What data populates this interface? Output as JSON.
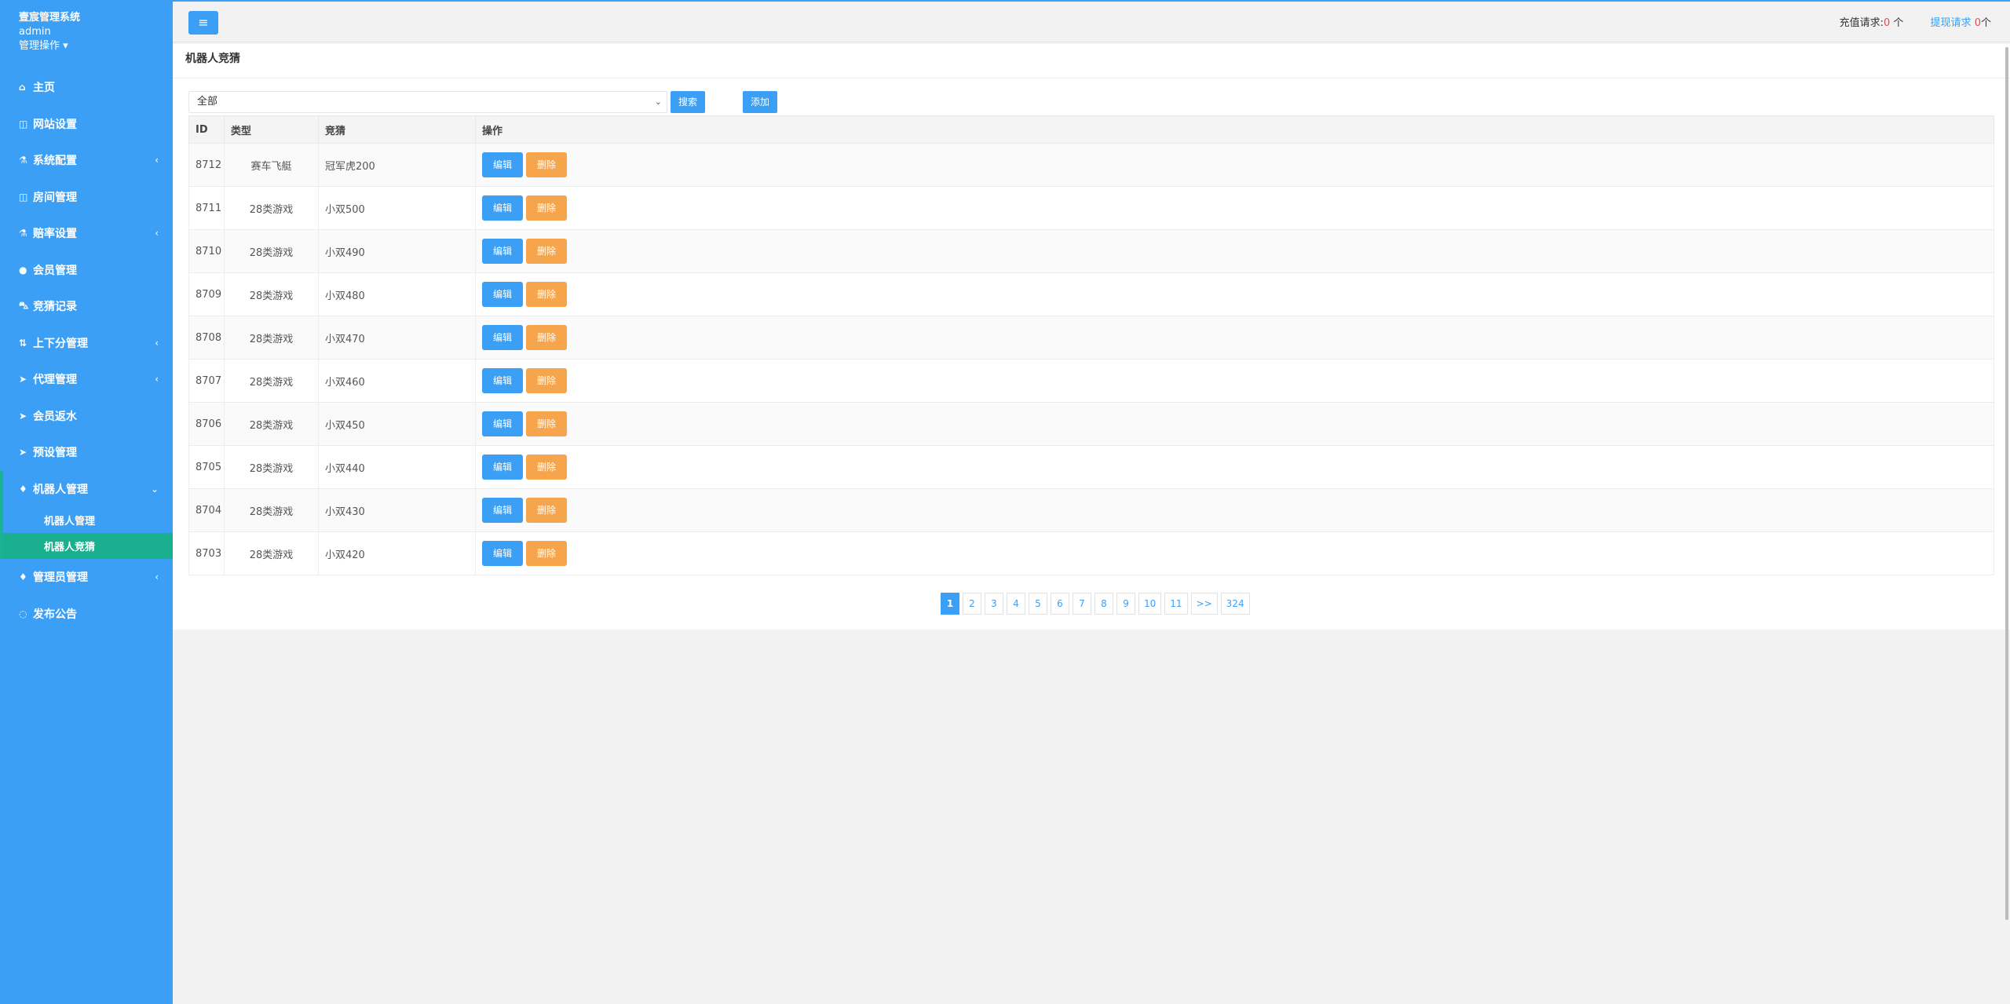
{
  "brand": {
    "title": "壹宸管理系统",
    "user": "admin",
    "role": "管理操作 ▾"
  },
  "nav": [
    {
      "icon": "⌂",
      "icon_name": "home-icon",
      "label": "主页",
      "chev": ""
    },
    {
      "icon": "◫",
      "icon_name": "columns-icon",
      "label": "网站设置",
      "chev": ""
    },
    {
      "icon": "⚗",
      "icon_name": "flask-icon",
      "label": "系统配置",
      "chev": "‹"
    },
    {
      "icon": "◫",
      "icon_name": "columns-icon",
      "label": "房间管理",
      "chev": ""
    },
    {
      "icon": "⚗",
      "icon_name": "flask-icon",
      "label": "赔率设置",
      "chev": "‹"
    },
    {
      "icon": "●",
      "icon_name": "user-icon",
      "label": "会员管理",
      "chev": ""
    },
    {
      "icon": "⛍",
      "icon_name": "car-icon",
      "label": "竞猜记录",
      "chev": ""
    },
    {
      "icon": "⇅",
      "icon_name": "updown-icon",
      "label": "上下分管理",
      "chev": "‹"
    },
    {
      "icon": "➤",
      "icon_name": "send-icon",
      "label": "代理管理",
      "chev": "‹"
    },
    {
      "icon": "➤",
      "icon_name": "send-icon",
      "label": "会员返水",
      "chev": ""
    },
    {
      "icon": "➤",
      "icon_name": "send-icon",
      "label": "预设管理",
      "chev": ""
    },
    {
      "icon": "♦",
      "icon_name": "robot-icon",
      "label": "机器人管理",
      "chev": "⌄"
    }
  ],
  "subnav": [
    {
      "label": "机器人管理"
    },
    {
      "label": "机器人竞猜"
    }
  ],
  "nav_after": [
    {
      "icon": "♦",
      "icon_name": "admin-icon",
      "label": "管理员管理",
      "chev": "‹"
    },
    {
      "icon": "◌",
      "icon_name": "chat-icon",
      "label": "发布公告",
      "chev": ""
    }
  ],
  "topbar": {
    "menu_icon": "≡",
    "recharge_label": "充值请求:",
    "recharge_count": "0",
    "recharge_unit": " 个",
    "withdraw_label": "提现请求",
    "withdraw_count": "0",
    "withdraw_unit": "个"
  },
  "panel": {
    "title": "机器人竞猜",
    "filter_value": "全部",
    "search_label": "搜索",
    "add_label": "添加"
  },
  "table": {
    "headers": [
      "ID",
      "类型",
      "竞猜",
      "操作"
    ],
    "edit_label": "编辑",
    "delete_label": "删除",
    "rows": [
      {
        "id": "8712",
        "type": "赛车飞艇",
        "guess": "冠军虎200"
      },
      {
        "id": "8711",
        "type": "28类游戏",
        "guess": "小双500"
      },
      {
        "id": "8710",
        "type": "28类游戏",
        "guess": "小双490"
      },
      {
        "id": "8709",
        "type": "28类游戏",
        "guess": "小双480"
      },
      {
        "id": "8708",
        "type": "28类游戏",
        "guess": "小双470"
      },
      {
        "id": "8707",
        "type": "28类游戏",
        "guess": "小双460"
      },
      {
        "id": "8706",
        "type": "28类游戏",
        "guess": "小双450"
      },
      {
        "id": "8705",
        "type": "28类游戏",
        "guess": "小双440"
      },
      {
        "id": "8704",
        "type": "28类游戏",
        "guess": "小双430"
      },
      {
        "id": "8703",
        "type": "28类游戏",
        "guess": "小双420"
      }
    ]
  },
  "pagination": [
    "1",
    "2",
    "3",
    "4",
    "5",
    "6",
    "7",
    "8",
    "9",
    "10",
    "11",
    ">>",
    "324"
  ],
  "pagination_active": "1"
}
